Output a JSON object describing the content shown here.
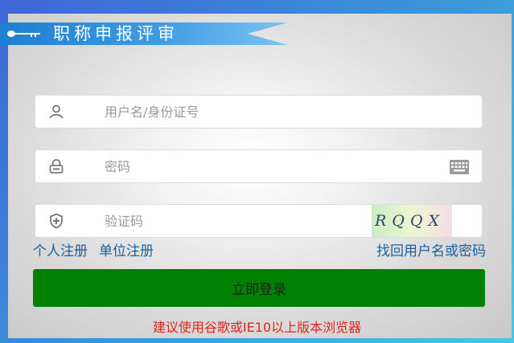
{
  "header": {
    "title": "职称申报评审"
  },
  "form": {
    "username_placeholder": "用户名/身份证号",
    "username_value": "",
    "password_placeholder": "密码",
    "password_value": "",
    "captcha_placeholder": "验证码",
    "captcha_value": "",
    "captcha_text": "RQQX"
  },
  "links": {
    "personal_register": "个人注册",
    "unit_register": "单位注册",
    "recover": "找回用户名或密码"
  },
  "login_label": "立即登录",
  "notice": "建议使用谷歌或IE10以上版本浏览器",
  "icons": {
    "title": "key-icon",
    "username": "user-icon",
    "password": "lock-icon",
    "captcha": "shield-plus-icon",
    "keyboard": "keyboard-icon"
  },
  "colors": {
    "login_button": "#008000",
    "link": "#1c5f9d",
    "notice": "#e0241b",
    "banner": "#3f9be3"
  }
}
